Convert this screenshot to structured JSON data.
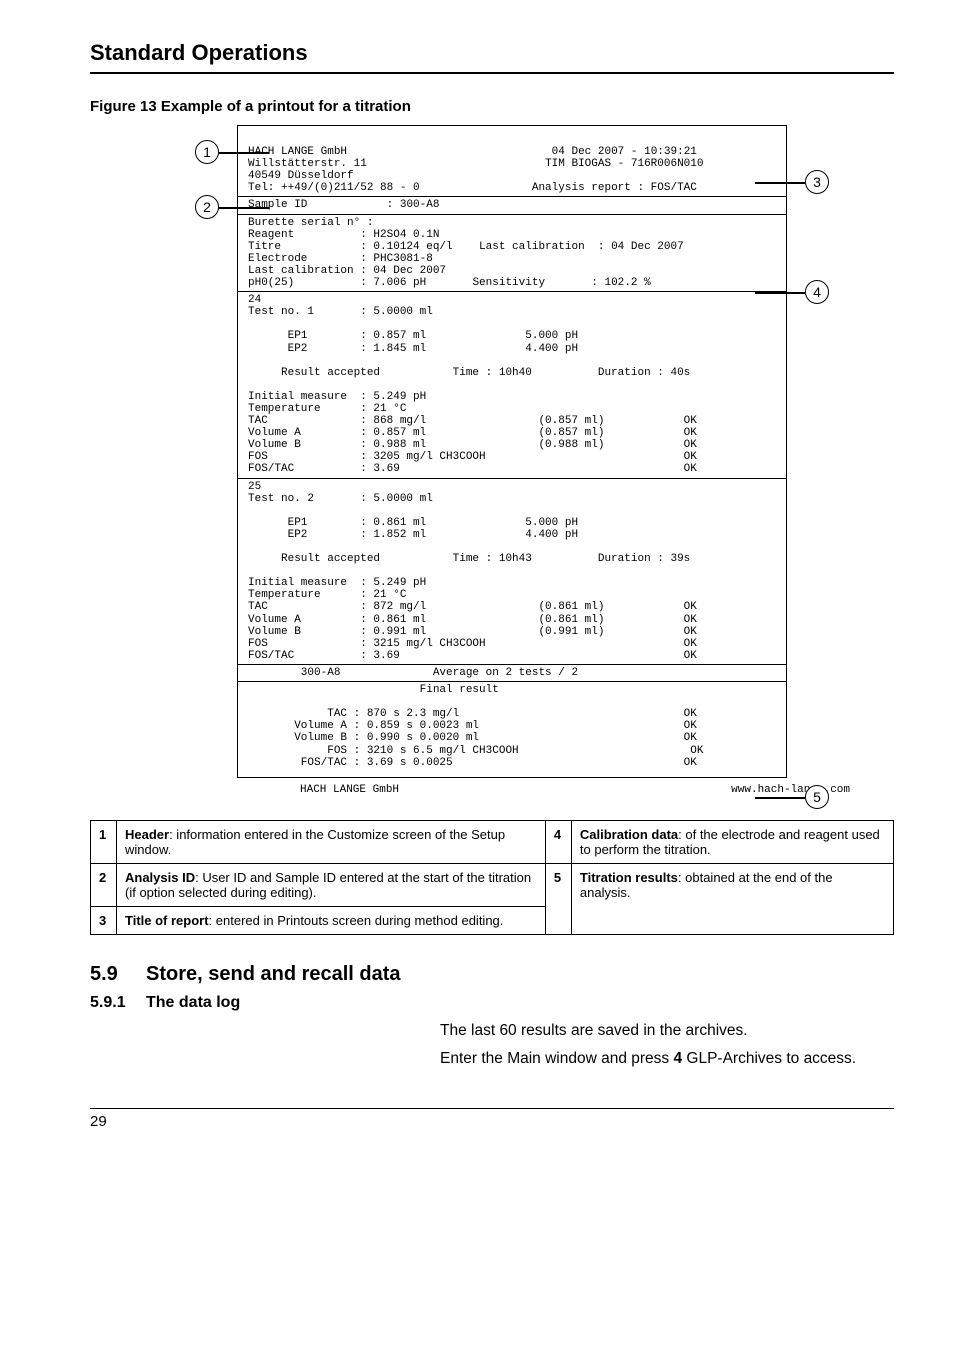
{
  "page": {
    "title": "Standard Operations",
    "figure_caption": "Figure 13 Example of a printout for a titration",
    "page_number": "29"
  },
  "callouts": {
    "c1": "1",
    "c2": "2",
    "c3": "3",
    "c4": "4",
    "c5": "5"
  },
  "printout": {
    "header_left_l1": "HACH LANGE GmbH",
    "header_left_l2": "Willstätterstr. 11",
    "header_left_l3": "40549 Düsseldorf",
    "header_left_l4": "Tel: ++49/(0)211/52 88 - 0",
    "header_right_l1": "04 Dec 2007 - 10:39:21",
    "header_right_l2": "TIM BIOGAS - 716R006N010",
    "header_right_l4": "Analysis report : FOS/TAC",
    "sample_id_label": "Sample ID",
    "sample_id_value": ": 300-A8",
    "burette": "Burette serial n° :",
    "reagent_l": "Reagent          : H2SO4 0.1N",
    "titre_l": "Titre            : 0.10124 eq/l",
    "titre_r": "Last calibration  : 04 Dec 2007",
    "electrode": "Electrode        : PHC3081-8",
    "lastcal": "Last calibration : 04 Dec 2007",
    "ph025_l": "pH0(25)          : 7.006 pH",
    "ph025_r": "Sensitivity       : 102.2 %",
    "t1_24": "24",
    "t1_testno": "Test no. 1       : 5.0000 ml",
    "t1_ep1": "      EP1        : 0.857 ml               5.000 pH",
    "t1_ep2": "      EP2        : 1.845 ml               4.400 pH",
    "t1_result": "     Result accepted           Time : 10h40          Duration : 40s",
    "t1_init": "Initial measure  : 5.249 pH",
    "t1_temp": "Temperature      : 21 °C",
    "t1_tac": "TAC              : 868 mg/l                 (0.857 ml)            OK",
    "t1_va": "Volume A         : 0.857 ml                 (0.857 ml)            OK",
    "t1_vb": "Volume B         : 0.988 ml                 (0.988 ml)            OK",
    "t1_fos": "FOS              : 3205 mg/l CH3COOH                              OK",
    "t1_fostac": "FOS/TAC          : 3.69                                           OK",
    "t2_25": "25",
    "t2_testno": "Test no. 2       : 5.0000 ml",
    "t2_ep1": "      EP1        : 0.861 ml               5.000 pH",
    "t2_ep2": "      EP2        : 1.852 ml               4.400 pH",
    "t2_result": "     Result accepted           Time : 10h43          Duration : 39s",
    "t2_init": "Initial measure  : 5.249 pH",
    "t2_temp": "Temperature      : 21 °C",
    "t2_tac": "TAC              : 872 mg/l                 (0.861 ml)            OK",
    "t2_va": "Volume A         : 0.861 ml                 (0.861 ml)            OK",
    "t2_vb": "Volume B         : 0.991 ml                 (0.991 ml)            OK",
    "t2_fos": "FOS              : 3215 mg/l CH3COOH                              OK",
    "t2_fostac": "FOS/TAC          : 3.69                                           OK",
    "avg_line": "        300-A8              Average on 2 tests / 2",
    "final_hdr": "                          Final result",
    "fr_tac": "            TAC : 870 s 2.3 mg/l                                  OK",
    "fr_va": "       Volume A : 0.859 s 0.0023 ml                               OK",
    "fr_vb": "       Volume B : 0.990 s 0.0020 ml                               OK",
    "fr_fos": "            FOS : 3210 s 6.5 mg/l CH3COOH                          OK",
    "fr_fostac": "        FOS/TAC : 3.69 s 0.0025                                   OK",
    "footer_left": "HACH LANGE GmbH",
    "footer_right": "www.hach-lange.com"
  },
  "legend": {
    "r1n": "1",
    "r1t_a": "Header",
    "r1t_b": ": information entered in the Customize screen of the Setup window.",
    "r2n": "2",
    "r2t_a": "Analysis ID",
    "r2t_b": ": User ID and Sample ID entered at the start of the titration (if option selected during editing).",
    "r3n": "3",
    "r3t_a": "Title of report",
    "r3t_b": ": entered in Printouts screen during method editing.",
    "r4n": "4",
    "r4t_a": "Calibration data",
    "r4t_b": ": of the electrode and reagent used to perform the titration.",
    "r5n": "5",
    "r5t_a": "Titration results",
    "r5t_b": ": obtained at the end of the analysis."
  },
  "sections": {
    "s59_num": "5.9",
    "s59_title": "Store, send and recall data",
    "s591_num": "5.9.1",
    "s591_title": "The data log",
    "body1": "The last 60 results are saved in the archives.",
    "body2_a": "Enter the Main window and press ",
    "body2_b": "4",
    "body2_c": " GLP-Archives to access."
  }
}
